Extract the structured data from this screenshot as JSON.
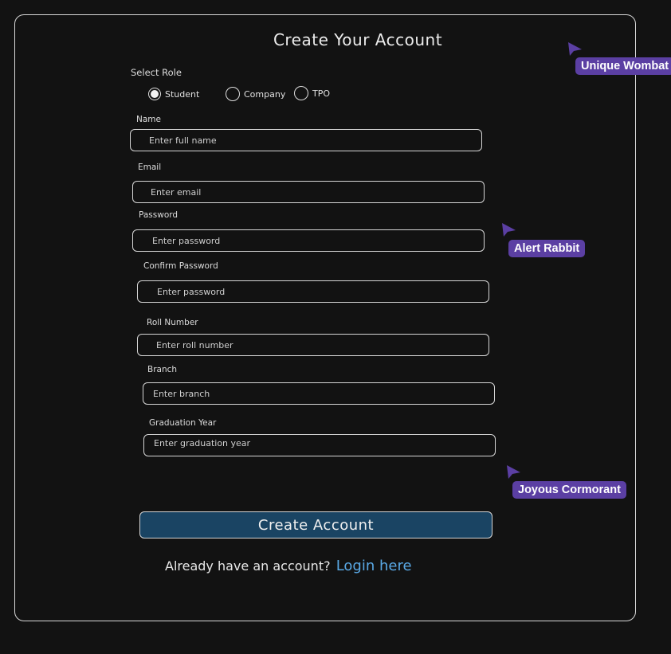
{
  "form": {
    "title": "Create Your Account",
    "role_label": "Select Role",
    "roles": [
      {
        "label": "Student",
        "selected": true
      },
      {
        "label": "Company",
        "selected": false
      },
      {
        "label": "TPO",
        "selected": false
      }
    ],
    "fields": {
      "name": {
        "label": "Name",
        "placeholder": "Enter full name"
      },
      "email": {
        "label": "Email",
        "placeholder": "Enter email"
      },
      "password": {
        "label": "Password",
        "placeholder": "Enter password"
      },
      "confirm_password": {
        "label": "Confirm Password",
        "placeholder": "Enter password"
      },
      "roll_number": {
        "label": "Roll Number",
        "placeholder": "Enter roll number"
      },
      "branch": {
        "label": "Branch",
        "placeholder": "Enter branch"
      },
      "graduation_year": {
        "label": "Graduation Year",
        "placeholder": "Enter graduation year"
      }
    },
    "submit_label": "Create Account",
    "login_prompt": "Already have an account?",
    "login_link": "Login here"
  },
  "collaborators": [
    {
      "name": "Unique Wombat",
      "color": "#5b3fa3"
    },
    {
      "name": "Alert Rabbit",
      "color": "#5b3fa3"
    },
    {
      "name": "Joyous Cormorant",
      "color": "#5b3fa3"
    }
  ],
  "colors": {
    "background": "#121212",
    "button": "#1a4463",
    "link": "#5aa9e6",
    "cursor": "#5b3fa3"
  }
}
